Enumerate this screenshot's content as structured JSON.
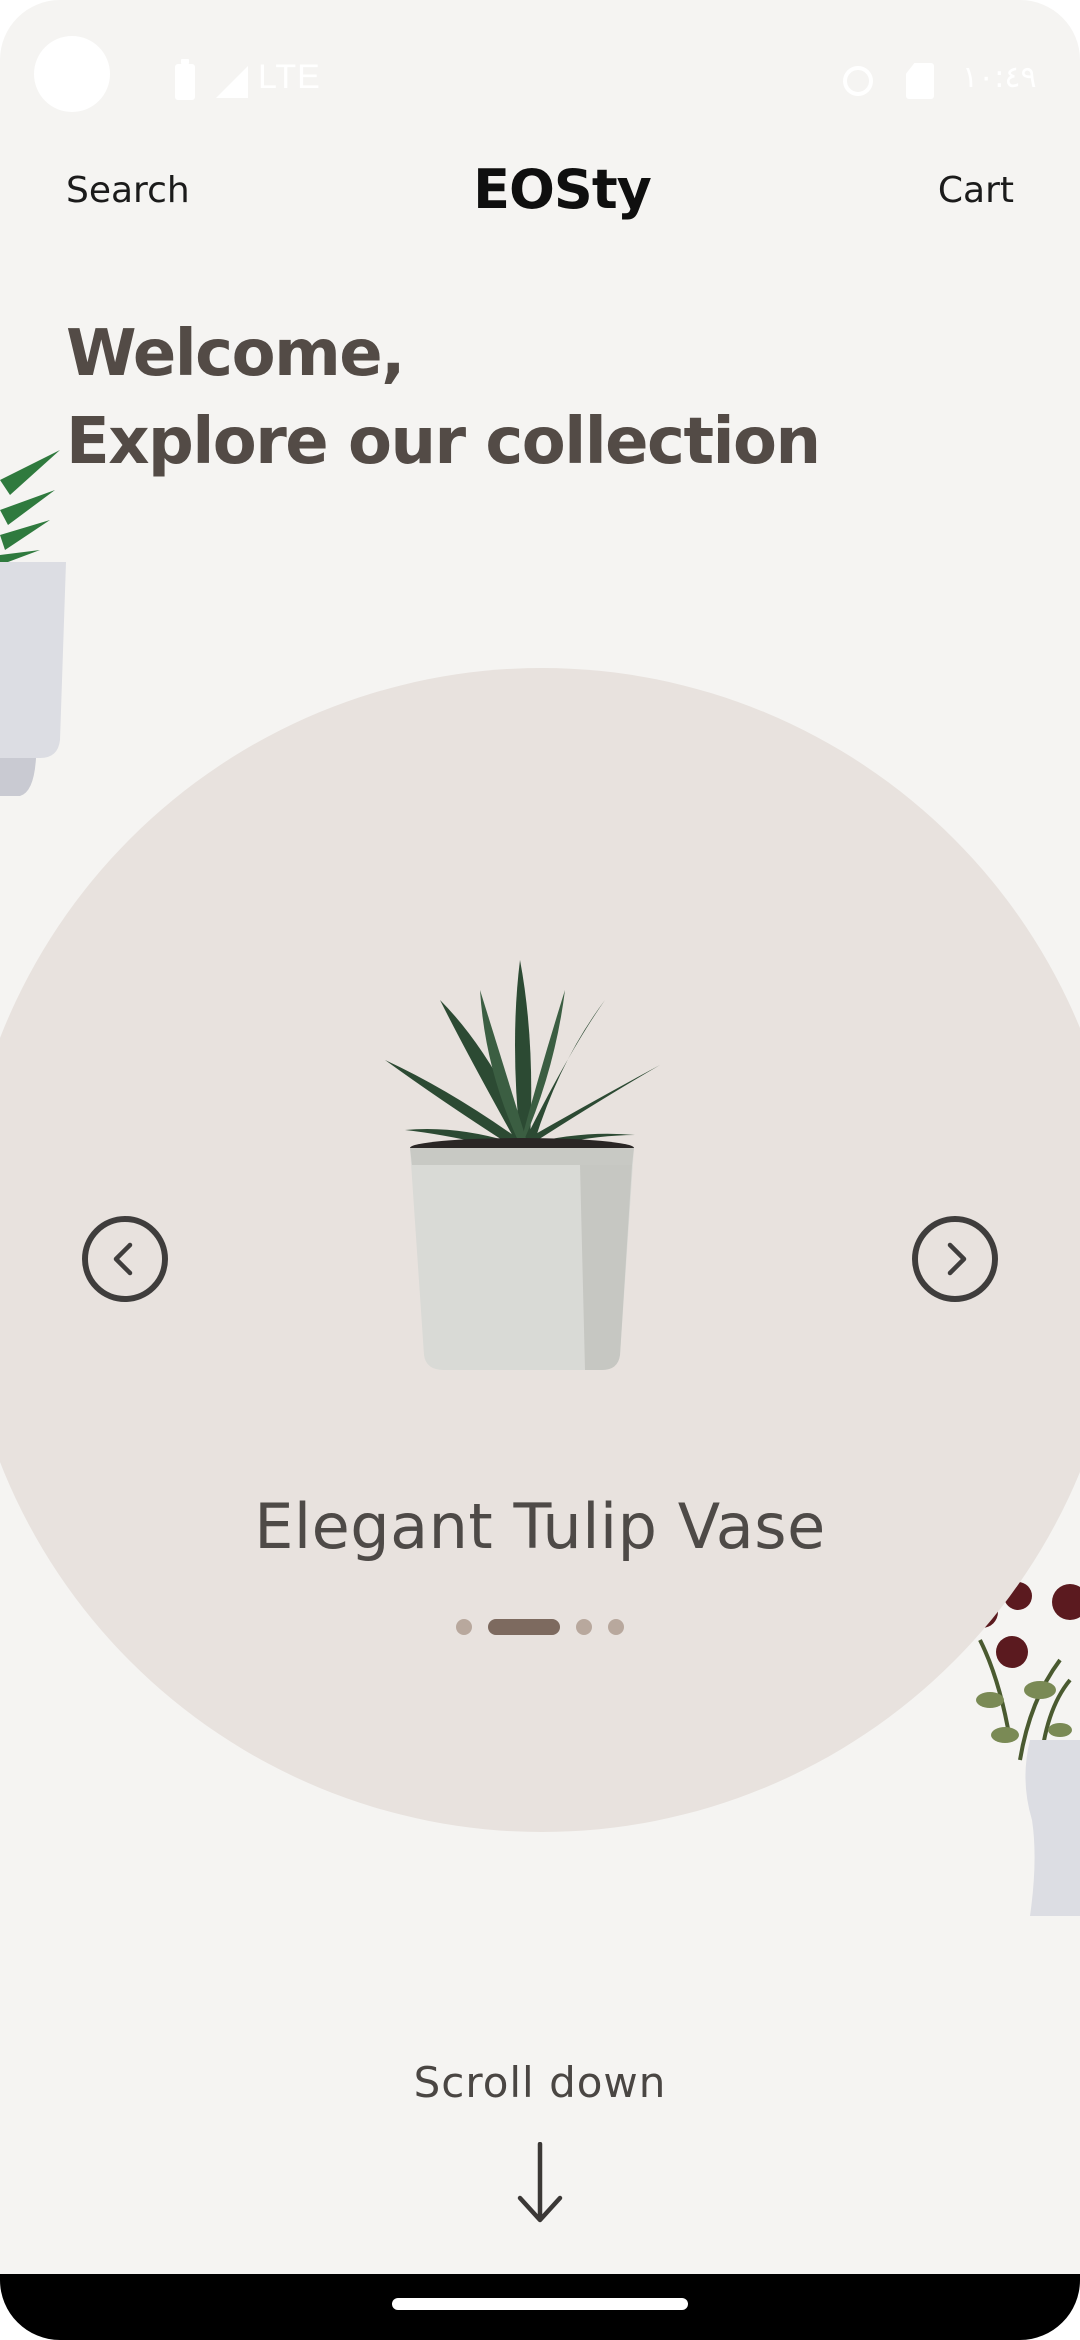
{
  "status_bar": {
    "network": "LTE",
    "time": "١٠:٤٩"
  },
  "header": {
    "search_label": "Search",
    "brand": "EOSty",
    "cart_label": "Cart"
  },
  "welcome": {
    "line1": "Welcome,",
    "line2": "Explore our collection"
  },
  "carousel": {
    "product_name": "Elegant Tulip Vase",
    "dot_count": 4,
    "active_index": 1,
    "prev_icon": "chevron-left-icon",
    "next_icon": "chevron-right-icon"
  },
  "scroll": {
    "label": "Scroll down",
    "icon": "arrow-down-icon"
  },
  "colors": {
    "background": "#f5f4f2",
    "circle": "#e8e2de",
    "heading": "#534b46",
    "dot_active": "#7d6a5f",
    "dot_inactive": "#b8a89d"
  }
}
